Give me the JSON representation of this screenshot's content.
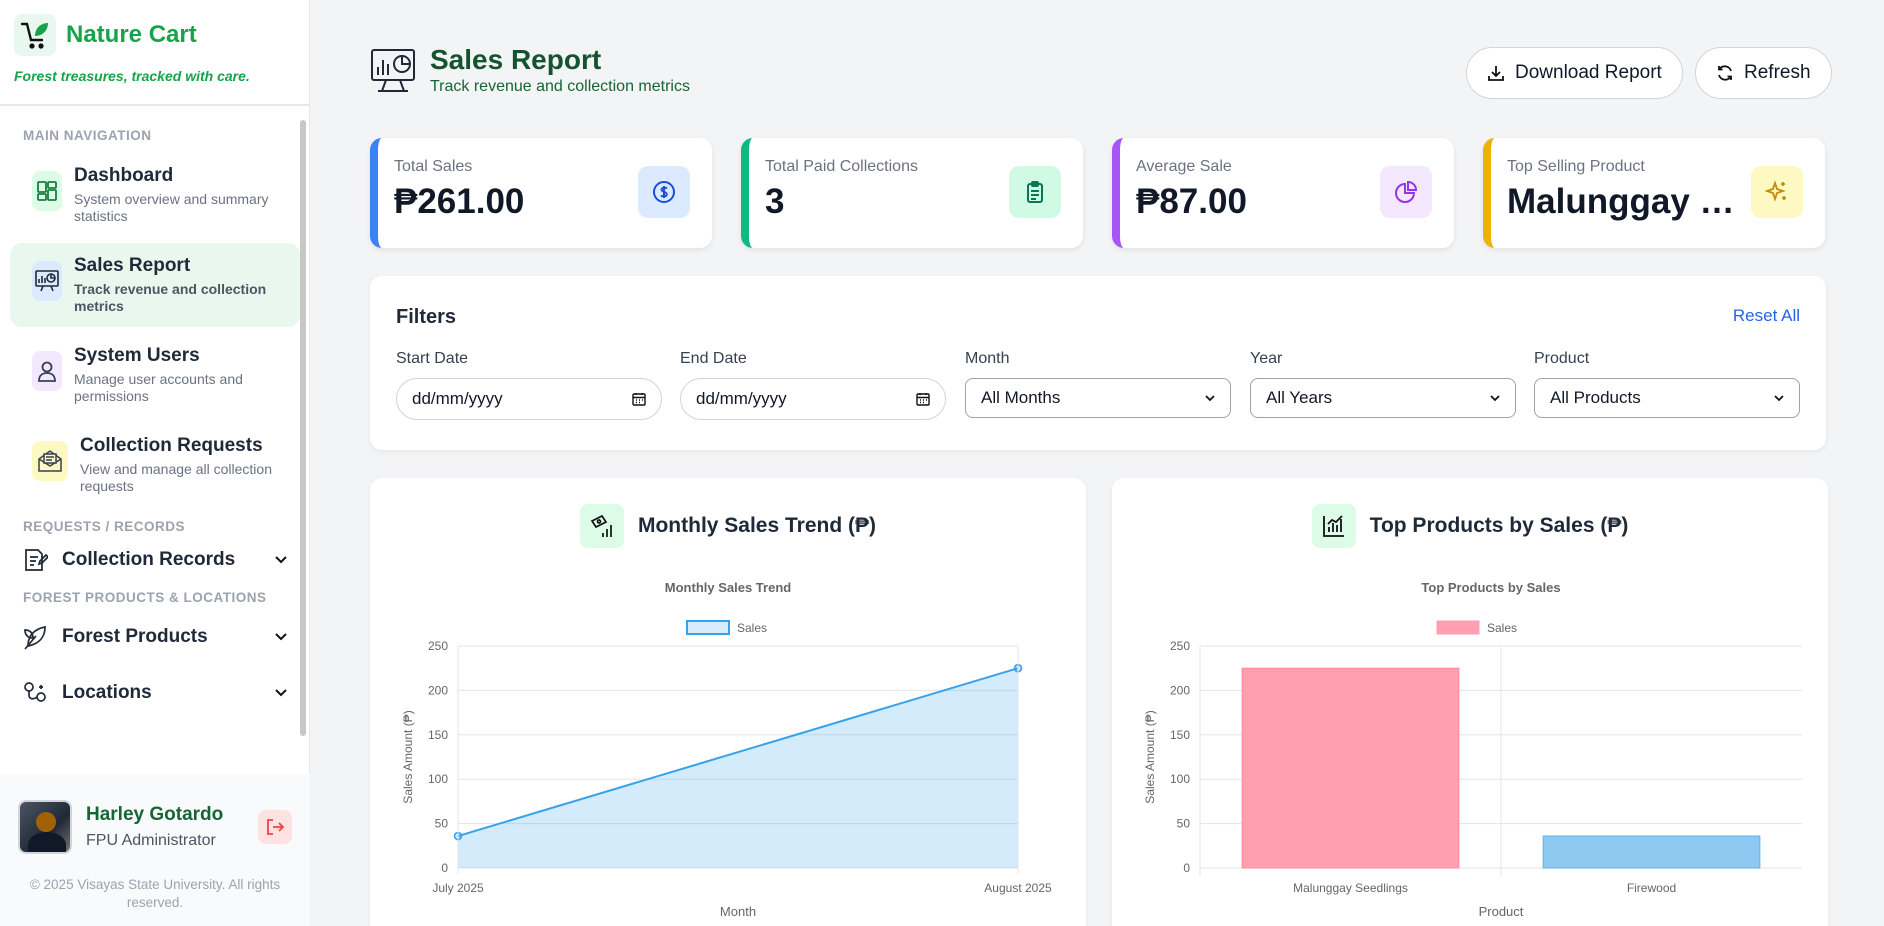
{
  "brand": {
    "name": "Nature Cart",
    "tagline": "Forest treasures, tracked with care."
  },
  "nav": {
    "section_main": "MAIN NAVIGATION",
    "items": [
      {
        "title": "Dashboard",
        "desc": "System overview and summary statistics",
        "icon": "dashboard-icon"
      },
      {
        "title": "Sales Report",
        "desc": "Track revenue and collection metrics",
        "icon": "sales-report-icon"
      },
      {
        "title": "System Users",
        "desc": "Manage user accounts and permissions",
        "icon": "user-icon"
      },
      {
        "title": "Collection Requests",
        "desc": "View and manage all collection requests",
        "icon": "envelope-icon"
      }
    ],
    "section_records": "REQUESTS / RECORDS",
    "collection_records": "Collection Records",
    "section_products": "FOREST PRODUCTS & LOCATIONS",
    "forest_products": "Forest Products",
    "locations": "Locations"
  },
  "profile": {
    "name": "Harley Gotardo",
    "role": "FPU Administrator"
  },
  "footer": {
    "copyright": "© 2025 Visayas State University. All rights reserved."
  },
  "header": {
    "title": "Sales Report",
    "subtitle": "Track revenue and collection metrics",
    "download_label": "Download Report",
    "refresh_label": "Refresh"
  },
  "cards": [
    {
      "label": "Total Sales",
      "value": "₱261.00",
      "color": "#3b82f6",
      "icon": "dollar-icon"
    },
    {
      "label": "Total Paid Collections",
      "value": "3",
      "color": "#10b981",
      "icon": "clipboard-icon"
    },
    {
      "label": "Average Sale",
      "value": "₱87.00",
      "color": "#a855f7",
      "icon": "pie-icon"
    },
    {
      "label": "Top Selling Product",
      "value": "Malunggay Seedlings",
      "color": "#eab308",
      "icon": "sparkle-icon"
    }
  ],
  "filters": {
    "title": "Filters",
    "reset_label": "Reset All",
    "start_date": {
      "label": "Start Date",
      "placeholder": "dd/mm/yyyy"
    },
    "end_date": {
      "label": "End Date",
      "placeholder": "dd/mm/yyyy"
    },
    "month": {
      "label": "Month",
      "value": "All Months"
    },
    "year": {
      "label": "Year",
      "value": "All Years"
    },
    "product": {
      "label": "Product",
      "value": "All Products"
    }
  },
  "panels": {
    "trend_title": "Monthly Sales Trend (₱)",
    "products_title": "Top Products by Sales (₱)"
  },
  "chart_data": [
    {
      "type": "area",
      "title": "Monthly Sales Trend",
      "x": [
        "July 2025",
        "August 2025"
      ],
      "series": [
        {
          "name": "Sales",
          "values": [
            36,
            225
          ]
        }
      ],
      "xlabel": "Month",
      "ylabel": "Sales Amount (₱)",
      "ylim": [
        0,
        250
      ],
      "yticks": [
        0,
        50,
        100,
        150,
        200,
        250
      ],
      "color": "#36a2eb"
    },
    {
      "type": "bar",
      "title": "Top Products by Sales",
      "categories": [
        "Malunggay Seedlings",
        "Firewood"
      ],
      "series": [
        {
          "name": "Sales",
          "values": [
            225,
            36
          ]
        }
      ],
      "bar_colors": [
        "#ff9fb0",
        "#8ec9f2"
      ],
      "xlabel": "Product",
      "ylabel": "Sales Amount (₱)",
      "ylim": [
        0,
        250
      ],
      "yticks": [
        0,
        50,
        100,
        150,
        200,
        250
      ]
    }
  ]
}
